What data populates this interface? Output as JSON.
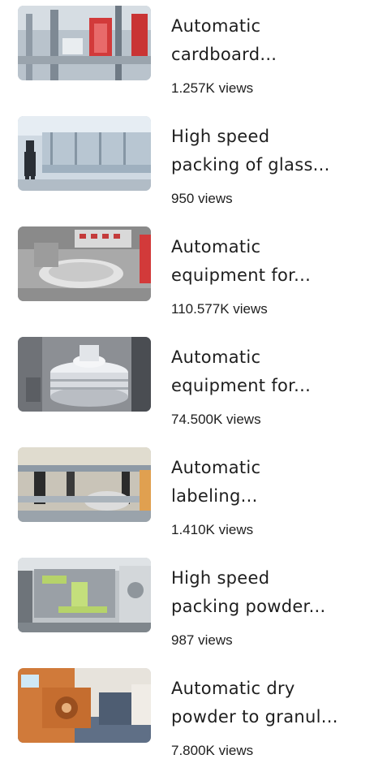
{
  "videos": [
    {
      "title": "Automatic\ncardboard...",
      "views": "1.257K views",
      "thumb_icon": "cardboard-machine-thumbnail",
      "palette": [
        "#b9c3cc",
        "#8f9aa5",
        "#d23a3a"
      ]
    },
    {
      "title": "High speed\npacking of glass...",
      "views": "950 views",
      "thumb_icon": "glass-packing-line-thumbnail",
      "palette": [
        "#cfd9e2",
        "#9fb0bf",
        "#2a2f36"
      ]
    },
    {
      "title": "Automatic\nequipment for...",
      "views": "110.577K views",
      "thumb_icon": "rotary-equipment-thumbnail",
      "palette": [
        "#a9a9a9",
        "#d9d9d9",
        "#c43b3b"
      ]
    },
    {
      "title": "Automatic\nequipment for...",
      "views": "74.500K views",
      "thumb_icon": "vibrating-sieve-thumbnail",
      "palette": [
        "#8c8f94",
        "#d8dbe0",
        "#4a4d52"
      ]
    },
    {
      "title": "Automatic\nlabeling...",
      "views": "1.410K views",
      "thumb_icon": "labeling-machine-thumbnail",
      "palette": [
        "#c9c4b8",
        "#8e9aa6",
        "#2b2b2b"
      ]
    },
    {
      "title": "High speed\npacking powder...",
      "views": "987 views",
      "thumb_icon": "powder-packing-thumbnail",
      "palette": [
        "#bfc4c8",
        "#b6d36a",
        "#6e747a"
      ]
    },
    {
      "title": "Automatic dry\npowder to granul...",
      "views": "7.800K views",
      "thumb_icon": "granulator-thumbnail",
      "palette": [
        "#d07a3a",
        "#5f6f86",
        "#e7e3dc"
      ]
    }
  ]
}
